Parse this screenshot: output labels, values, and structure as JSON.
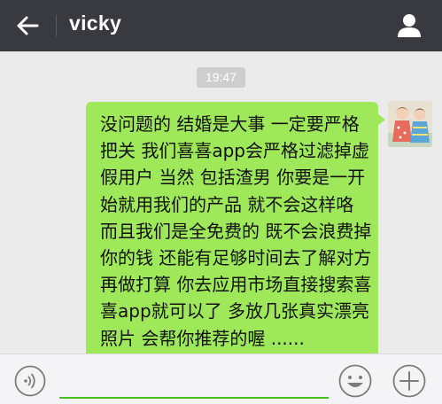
{
  "header": {
    "title": "vicky",
    "back_icon": "back-arrow-icon",
    "profile_icon": "person-icon"
  },
  "chat": {
    "timestamp": "19:47",
    "message": {
      "lines": [
        "没问题的 结婚是大事 一定要严格",
        "把关 我们喜喜app会严格过滤掉虚",
        "假用户 当然 包括渣男 你要是一开",
        "始就用我们的产品 就不会这样咯",
        "而且我们是全免费的 既不会浪费掉",
        "你的钱 还能有足够时间去了解对方",
        "再做打算 你去应用市场直接搜索喜",
        "喜app就可以了 多放几张真实漂亮",
        "照片 会帮你推荐的喔 ......"
      ],
      "bubble_color": "#9ee85a"
    }
  },
  "input_bar": {
    "voice_icon": "voice-icon",
    "emoji_icon": "smiley-icon",
    "more_icon": "plus-icon",
    "text_value": "",
    "accent_color": "#45c01a"
  },
  "colors": {
    "topbar": "#393a3f",
    "background": "#ebebeb"
  }
}
